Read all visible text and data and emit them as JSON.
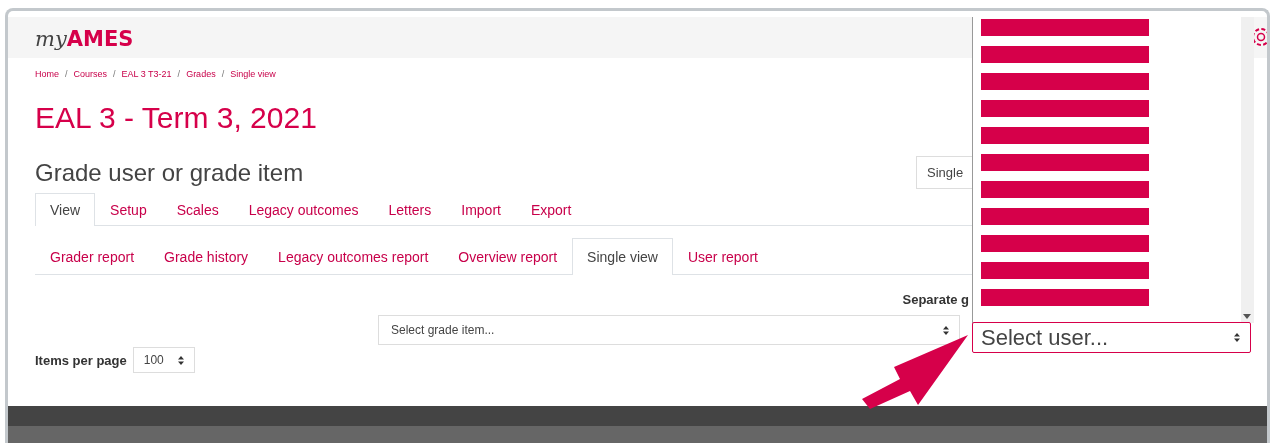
{
  "header": {
    "logo_prefix": "my",
    "logo_brand": "AMES"
  },
  "breadcrumb": [
    "Home",
    "Courses",
    "EAL 3 T3-21",
    "Grades",
    "Single view"
  ],
  "breadcrumb_separator": "/",
  "course_title": "EAL 3 - Term 3, 2021",
  "page_heading": "Grade user or grade item",
  "view_select": {
    "value": "Single"
  },
  "tabs": [
    {
      "label": "View",
      "selected": true
    },
    {
      "label": "Setup",
      "selected": false
    },
    {
      "label": "Scales",
      "selected": false
    },
    {
      "label": "Legacy outcomes",
      "selected": false
    },
    {
      "label": "Letters",
      "selected": false
    },
    {
      "label": "Import",
      "selected": false
    },
    {
      "label": "Export",
      "selected": false
    }
  ],
  "subtabs": [
    {
      "label": "Grader report",
      "selected": false
    },
    {
      "label": "Grade history",
      "selected": false
    },
    {
      "label": "Legacy outcomes report",
      "selected": false
    },
    {
      "label": "Overview report",
      "selected": false
    },
    {
      "label": "Single view",
      "selected": true
    },
    {
      "label": "User report",
      "selected": false
    }
  ],
  "group_label": "Separate g",
  "grade_item_select": {
    "placeholder": "Select grade item..."
  },
  "user_select": {
    "placeholder": "Select user...",
    "expanded": true
  },
  "user_options": [
    {
      "kind": "redacted"
    },
    {
      "kind": "redacted"
    },
    {
      "kind": "redacted"
    },
    {
      "kind": "redacted"
    },
    {
      "kind": "redacted"
    },
    {
      "kind": "redacted"
    },
    {
      "kind": "redacted"
    },
    {
      "kind": "redacted"
    },
    {
      "kind": "redacted"
    },
    {
      "kind": "redacted"
    },
    {
      "kind": "redacted"
    }
  ],
  "items_per_page": {
    "label": "Items per page",
    "value": "100"
  }
}
